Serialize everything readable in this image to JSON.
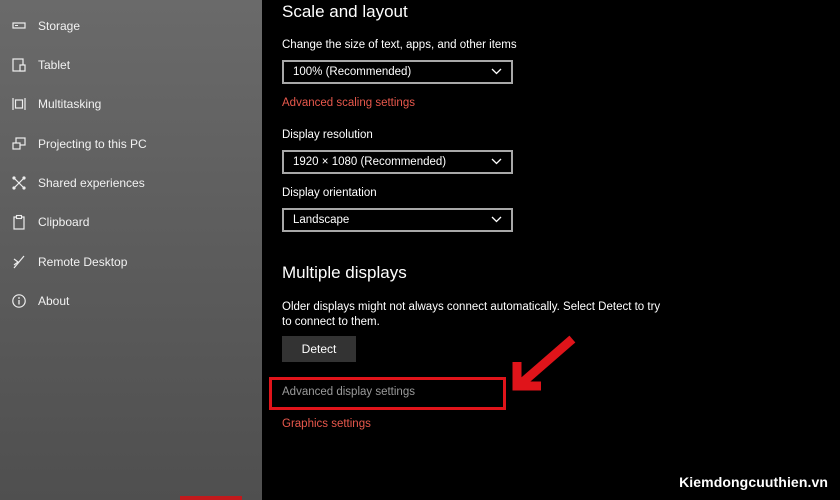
{
  "sidebar": {
    "items": [
      {
        "label": "Storage",
        "icon": "storage-icon"
      },
      {
        "label": "Tablet",
        "icon": "tablet-icon"
      },
      {
        "label": "Multitasking",
        "icon": "multitasking-icon"
      },
      {
        "label": "Projecting to this PC",
        "icon": "projecting-icon"
      },
      {
        "label": "Shared experiences",
        "icon": "shared-experiences-icon"
      },
      {
        "label": "Clipboard",
        "icon": "clipboard-icon"
      },
      {
        "label": "Remote Desktop",
        "icon": "remote-desktop-icon"
      },
      {
        "label": "About",
        "icon": "info-icon"
      }
    ]
  },
  "scale": {
    "heading": "Scale and layout",
    "size_label": "Change the size of text, apps, and other items",
    "size_value": "100% (Recommended)",
    "advanced_scaling_link": "Advanced scaling settings",
    "resolution_label": "Display resolution",
    "resolution_value": "1920 × 1080 (Recommended)",
    "orientation_label": "Display orientation",
    "orientation_value": "Landscape"
  },
  "multiple": {
    "heading": "Multiple displays",
    "description": "Older displays might not always connect automatically. Select Detect to try to connect to them.",
    "detect_button": "Detect",
    "advanced_display_link": "Advanced display settings",
    "graphics_link": "Graphics settings"
  },
  "watermark": "Kiemdongcuuthien.vn",
  "colors": {
    "link": "#e8584c",
    "highlight": "#e0141a",
    "sidebar": "#5f5f5f"
  }
}
